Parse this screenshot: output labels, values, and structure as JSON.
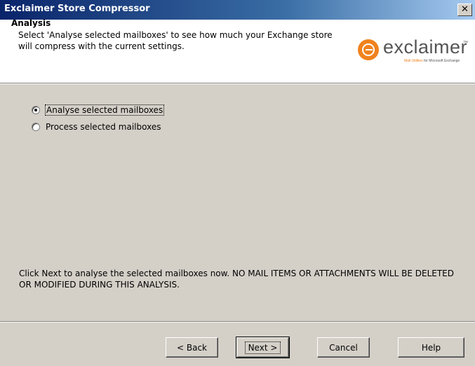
{
  "window": {
    "title": "Exclaimer Store Compressor",
    "close_glyph": "✕"
  },
  "header": {
    "title": "Analysis",
    "description": "Select 'Analyse selected mailboxes' to see how much your Exchange store will compress with the current settings.",
    "logo": {
      "wordmark": "exclaimer",
      "trademark": "™",
      "tagline_a": "Mail Utilities",
      "tagline_b": "for Microsoft Exchange",
      "icon": "exclaimer-logo-icon",
      "brand_color": "#f0821e"
    }
  },
  "options": [
    {
      "label": "Analyse selected mailboxes",
      "selected": true
    },
    {
      "label": "Process selected mailboxes",
      "selected": false
    }
  ],
  "info": {
    "text": "Click Next to analyse the selected mailboxes now. NO MAIL ITEMS OR ATTACHMENTS WILL BE DELETED OR MODIFIED DURING THIS ANALYSIS."
  },
  "buttons": {
    "back": "< Back",
    "next": "Next >",
    "cancel": "Cancel",
    "help": "Help"
  },
  "colors": {
    "dialog_bg": "#d4d0c8",
    "titlebar_start": "#0a246a",
    "titlebar_end": "#a6caf0",
    "accent": "#f0821e"
  }
}
